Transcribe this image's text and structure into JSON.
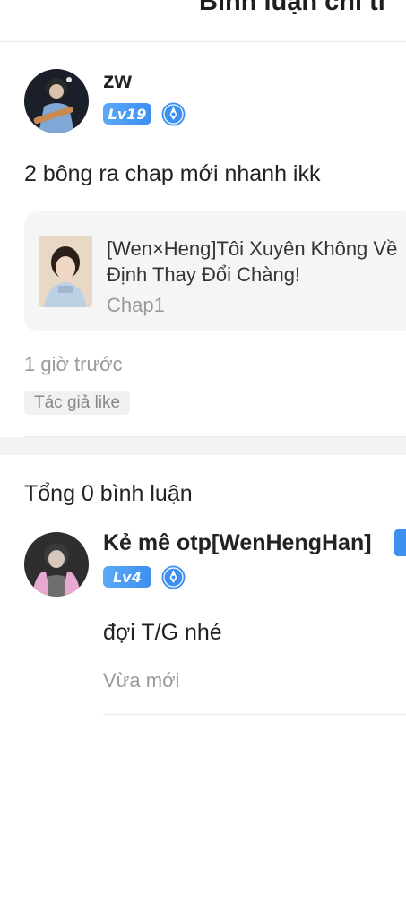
{
  "header": {
    "title": "Bình luận chi ti"
  },
  "post": {
    "username": "zw",
    "level": "Lv19",
    "text": "2 bông ra chap mới nhanh ikk",
    "card": {
      "title": "[Wen×Heng]Tôi Xuyên Không Về Định Thay Đổi Chàng!",
      "chapter": "Chap1"
    },
    "time": "1 giờ trước",
    "like_tag": "Tác giả like"
  },
  "replies": {
    "total_label": "Tổng 0 bình luận",
    "items": [
      {
        "username": "Kẻ mê otp[WenHengHan]",
        "level": "Lv4",
        "text": "đợi T/G nhé",
        "time": "Vừa mới"
      }
    ]
  },
  "colors": {
    "accent": "#3d8ff0",
    "muted": "#9a9a9a"
  }
}
